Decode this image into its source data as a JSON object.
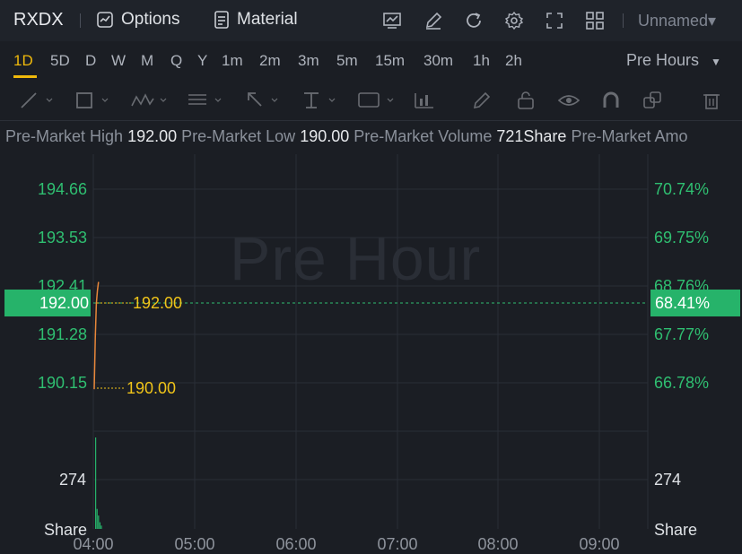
{
  "toolbar": {
    "ticker": "RXDX",
    "options_label": "Options",
    "material_label": "Material",
    "layout_name": "Unnamed▾",
    "icons": [
      "indicator-icon",
      "draw-icon",
      "refresh-icon",
      "settings-icon",
      "fullscreen-icon",
      "layout-grid-icon"
    ]
  },
  "timeframes": [
    "1D",
    "5D",
    "D",
    "W",
    "M",
    "Q",
    "Y",
    "1m",
    "2m",
    "3m",
    "5m",
    "15m",
    "30m",
    "1h",
    "2h"
  ],
  "active_timeframe": "1D",
  "session_select": "Pre Hours",
  "drawing_tools": [
    "trendline-icon",
    "rectangle-icon",
    "pattern-icon",
    "fib-icon",
    "arrow-icon",
    "text-tool-icon",
    "note-icon",
    "bars-pattern-icon",
    "pen-icon",
    "lock-icon",
    "eye-icon",
    "magnet-icon",
    "layers-icon",
    "trash-icon"
  ],
  "info": {
    "high_label": "Pre-Market High",
    "high_value": "192.00",
    "low_label": "Pre-Market Low",
    "low_value": "190.00",
    "volume_label": "Pre-Market Volume",
    "volume_value": "721Share",
    "amount_label": "Pre-Market Amo"
  },
  "chart": {
    "watermark": "Pre Hour",
    "price_ticks": [
      "194.66",
      "193.53",
      "192.41",
      "191.28",
      "190.15"
    ],
    "percent_ticks": [
      "70.74%",
      "69.75%",
      "68.76%",
      "67.77%",
      "66.78%"
    ],
    "current_price": "192.00",
    "current_percent": "68.41%",
    "high_marker": "192.00",
    "low_marker": "190.00",
    "volume_tick": "274",
    "volume_unit": "Share",
    "time_ticks": [
      "04:00",
      "05:00",
      "06:00",
      "07:00",
      "08:00",
      "09:00"
    ],
    "colors": {
      "up": "#26b36a",
      "line": "#e8873a",
      "marker": "#f0c419"
    }
  },
  "chart_data": {
    "type": "line",
    "title": "Pre Hour",
    "x": [
      "04:00",
      "04:01",
      "04:02",
      "04:03",
      "04:04"
    ],
    "series": [
      {
        "values": [
          190.0,
          191.2,
          192.0,
          192.3,
          192.5
        ]
      }
    ],
    "volume": [
      274,
      60,
      40,
      20,
      10
    ],
    "ylim": [
      190.15,
      194.66
    ],
    "y2ticks": [
      "70.74%",
      "69.75%",
      "68.76%",
      "67.77%",
      "66.78%"
    ],
    "xticks": [
      "04:00",
      "05:00",
      "06:00",
      "07:00",
      "08:00",
      "09:00"
    ]
  }
}
